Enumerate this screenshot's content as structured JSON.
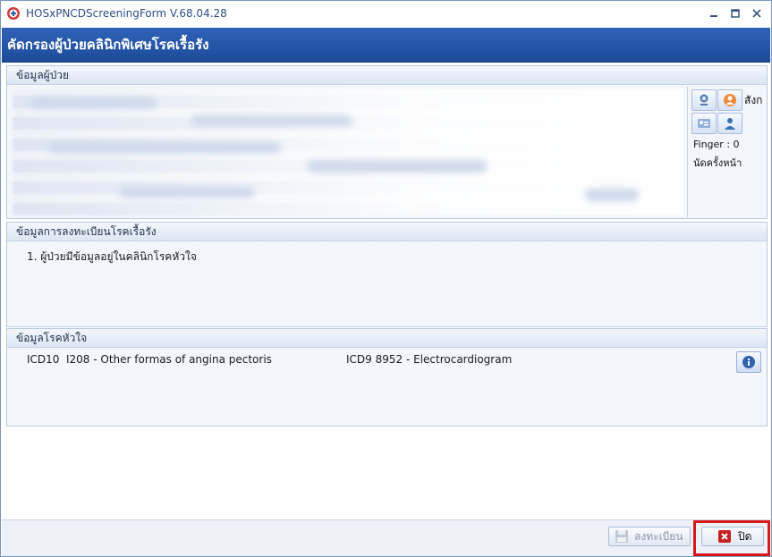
{
  "window": {
    "title": "HOSxPNCDScreeningForm V.68.04.28"
  },
  "header": {
    "title": "คัดกรองผู้ป่วยคลินิกพิเศษโรคเรื้อรัง"
  },
  "patient_panel": {
    "title": "ข้อมูลผู้ป่วย",
    "side_label_truncated": "สังก",
    "finger_text": "Finger : 0",
    "appointment_text": "นัดครั้งหน้า"
  },
  "registry_panel": {
    "title": "ข้อมูลการลงทะเบียนโรคเรื้อรัง",
    "items": [
      "1. ผู้ป่วยมีข้อมูลอยู่ในคลินิกโรคหัวใจ"
    ]
  },
  "heart_panel": {
    "title": "ข้อมูลโรคหัวใจ",
    "icd10_label": "ICD10",
    "icd10_value": "I208 - Other formas of angina pectoris",
    "icd9_value": "ICD9 8952 - Electrocardiogram"
  },
  "footer": {
    "register_label": "ลงทะเบียน",
    "close_label": "ปิด"
  },
  "colors": {
    "header_bg": "#1c4a99",
    "highlight": "#d81818",
    "close_icon": "#c62020"
  }
}
